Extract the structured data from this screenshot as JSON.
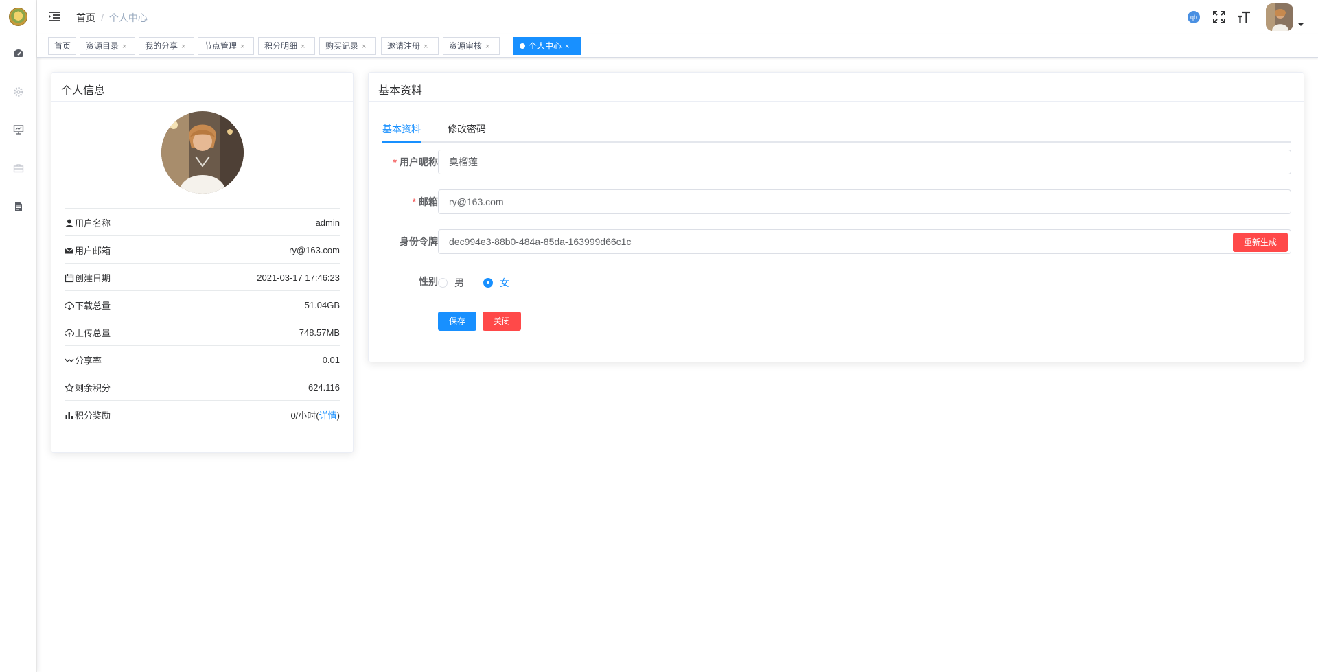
{
  "colors": {
    "primary": "#1890ff",
    "danger": "#ff4949",
    "border": "#dcdfe6"
  },
  "sidebar": {
    "icons": [
      "logo",
      "dashboard-icon",
      "gear-icon",
      "monitor-icon",
      "briefcase-icon",
      "document-icon"
    ]
  },
  "navbar": {
    "breadcrumb": {
      "home": "首页",
      "separator": "/",
      "current": "个人中心"
    },
    "qb_badge": "qb"
  },
  "tags": [
    {
      "label": "首页",
      "closable": false
    },
    {
      "label": "资源目录",
      "closable": true
    },
    {
      "label": "我的分享",
      "closable": true
    },
    {
      "label": "节点管理",
      "closable": true
    },
    {
      "label": "积分明细",
      "closable": true
    },
    {
      "label": "购买记录",
      "closable": true
    },
    {
      "label": "邀请注册",
      "closable": true
    },
    {
      "label": "资源审核",
      "closable": true
    },
    {
      "label": "个人中心",
      "closable": true,
      "active": true
    }
  ],
  "tag_close": "×",
  "profile_card": {
    "title": "个人信息",
    "rows": [
      {
        "icon": "user-icon",
        "label": "用户名称",
        "value": "admin"
      },
      {
        "icon": "mail-icon",
        "label": "用户邮箱",
        "value": "ry@163.com"
      },
      {
        "icon": "calendar-icon",
        "label": "创建日期",
        "value": "2021-03-17 17:46:23"
      },
      {
        "icon": "cloud-download-icon",
        "label": "下载总量",
        "value": "51.04GB"
      },
      {
        "icon": "cloud-upload-icon",
        "label": "上传总量",
        "value": "748.57MB"
      },
      {
        "icon": "share-ratio-icon",
        "label": "分享率",
        "value": "0.01"
      },
      {
        "icon": "star-icon",
        "label": "剩余积分",
        "value": "624.116"
      },
      {
        "icon": "bar-chart-icon",
        "label": "积分奖励",
        "value": "0/小时",
        "link_open": "(",
        "link": "详情",
        "link_close": ")"
      }
    ]
  },
  "basic_card": {
    "title": "基本资料",
    "tabs": [
      "基本资料",
      "修改密码"
    ],
    "form": {
      "nickname": {
        "label": "用户昵称",
        "value": "臭榴莲",
        "required": "*"
      },
      "email": {
        "label": "邮箱",
        "value": "ry@163.com",
        "required": "*"
      },
      "token": {
        "label": "身份令牌",
        "value": "dec994e3-88b0-484a-85da-163999d66c1c",
        "button": "重新生成"
      },
      "gender": {
        "label": "性别",
        "options": [
          "男",
          "女"
        ],
        "selected": "女"
      }
    },
    "buttons": {
      "save": "保存",
      "close": "关闭"
    }
  }
}
